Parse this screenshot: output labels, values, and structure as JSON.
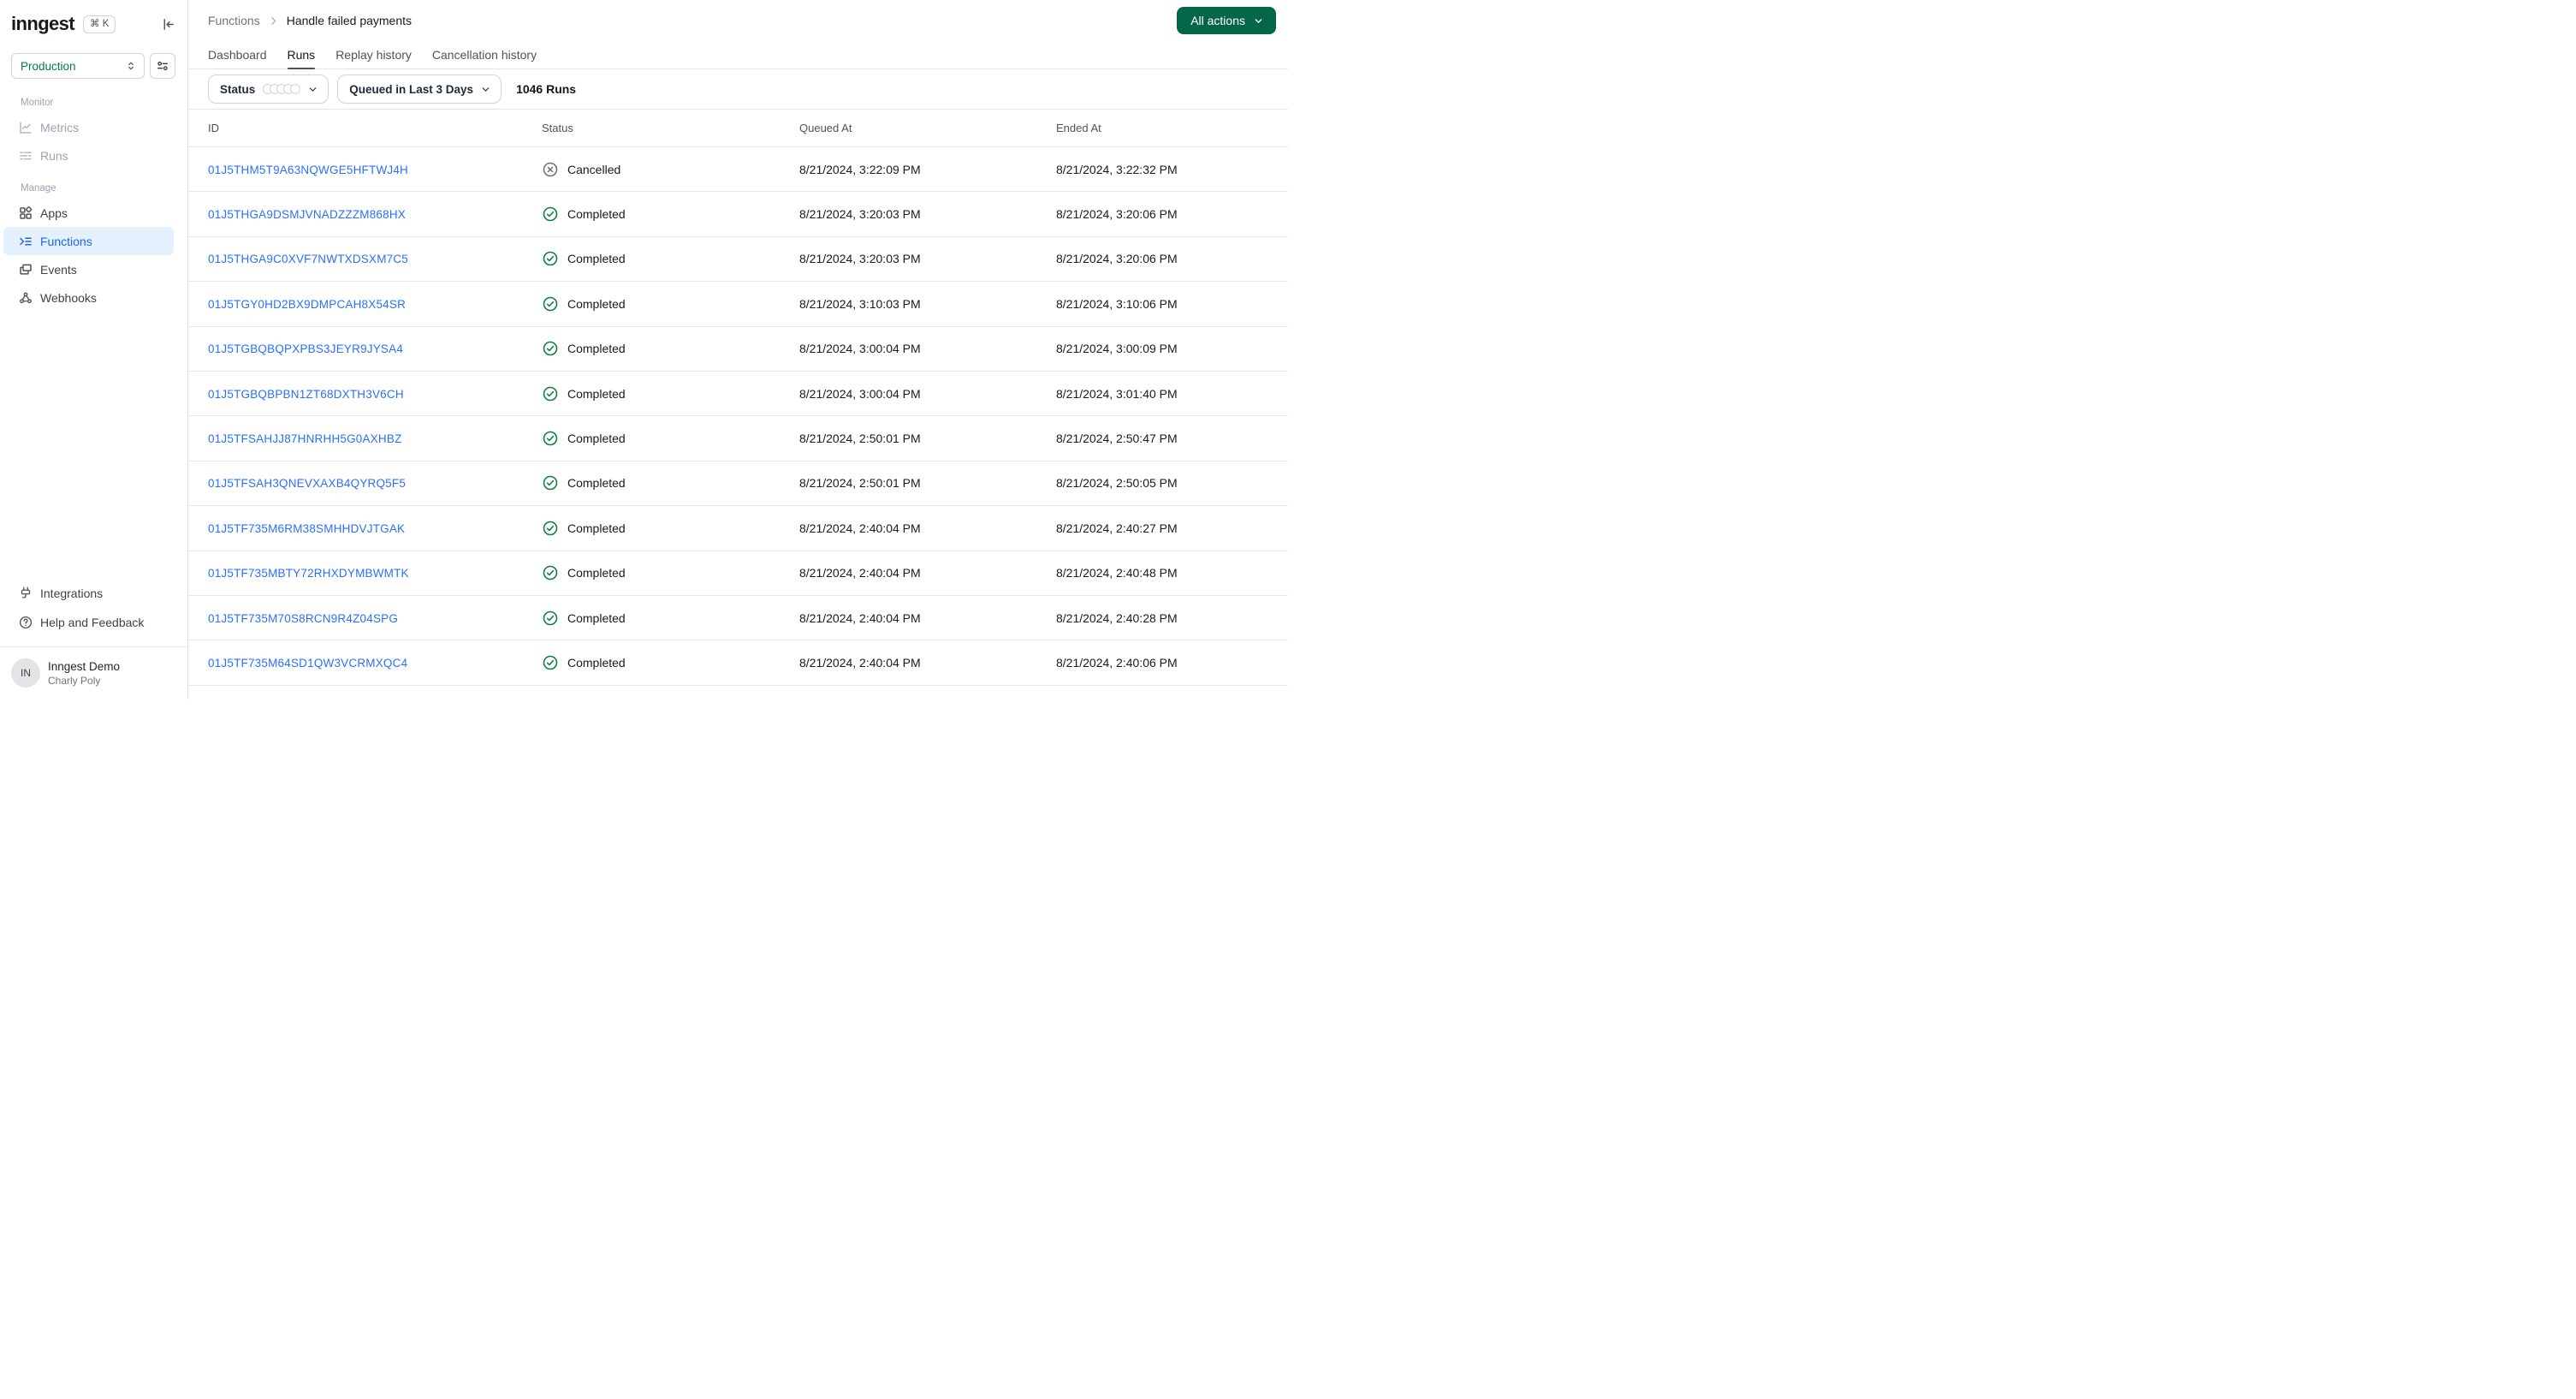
{
  "app": {
    "logo": "inngest",
    "command_shortcut": "⌘ K"
  },
  "environment": {
    "selected": "Production"
  },
  "sidebar": {
    "sections": [
      {
        "label": "Monitor",
        "items": [
          {
            "label": "Metrics"
          },
          {
            "label": "Runs"
          }
        ]
      },
      {
        "label": "Manage",
        "items": [
          {
            "label": "Apps"
          },
          {
            "label": "Functions",
            "active": true
          },
          {
            "label": "Events"
          },
          {
            "label": "Webhooks"
          }
        ]
      }
    ],
    "footer_items": [
      {
        "label": "Integrations"
      },
      {
        "label": "Help and Feedback"
      }
    ],
    "user": {
      "initials": "IN",
      "org": "Inngest Demo",
      "name": "Charly Poly"
    }
  },
  "header": {
    "breadcrumb": {
      "parent": "Functions",
      "current": "Handle failed payments"
    },
    "actions_button": "All actions",
    "tabs": [
      {
        "label": "Dashboard"
      },
      {
        "label": "Runs",
        "active": true
      },
      {
        "label": "Replay history"
      },
      {
        "label": "Cancellation history"
      }
    ]
  },
  "filters": {
    "status_label": "Status",
    "time_range_label": "Queued in Last 3 Days",
    "runs_count": "1046 Runs"
  },
  "table": {
    "columns": {
      "id": "ID",
      "status": "Status",
      "queued_at": "Queued At",
      "ended_at": "Ended At"
    },
    "rows": [
      {
        "id": "01J5THM5T9A63NQWGE5HFTWJ4H",
        "status": "Cancelled",
        "queued_at": "8/21/2024, 3:22:09 PM",
        "ended_at": "8/21/2024, 3:22:32 PM"
      },
      {
        "id": "01J5THGA9DSMJVNADZZZM868HX",
        "status": "Completed",
        "queued_at": "8/21/2024, 3:20:03 PM",
        "ended_at": "8/21/2024, 3:20:06 PM"
      },
      {
        "id": "01J5THGA9C0XVF7NWTXDSXM7C5",
        "status": "Completed",
        "queued_at": "8/21/2024, 3:20:03 PM",
        "ended_at": "8/21/2024, 3:20:06 PM"
      },
      {
        "id": "01J5TGY0HD2BX9DMPCAH8X54SR",
        "status": "Completed",
        "queued_at": "8/21/2024, 3:10:03 PM",
        "ended_at": "8/21/2024, 3:10:06 PM"
      },
      {
        "id": "01J5TGBQBQPXPBS3JEYR9JYSA4",
        "status": "Completed",
        "queued_at": "8/21/2024, 3:00:04 PM",
        "ended_at": "8/21/2024, 3:00:09 PM"
      },
      {
        "id": "01J5TGBQBPBN1ZT68DXTH3V6CH",
        "status": "Completed",
        "queued_at": "8/21/2024, 3:00:04 PM",
        "ended_at": "8/21/2024, 3:01:40 PM"
      },
      {
        "id": "01J5TFSAHJJ87HNRHH5G0AXHBZ",
        "status": "Completed",
        "queued_at": "8/21/2024, 2:50:01 PM",
        "ended_at": "8/21/2024, 2:50:47 PM"
      },
      {
        "id": "01J5TFSAH3QNEVXAXB4QYRQ5F5",
        "status": "Completed",
        "queued_at": "8/21/2024, 2:50:01 PM",
        "ended_at": "8/21/2024, 2:50:05 PM"
      },
      {
        "id": "01J5TF735M6RM38SMHHDVJTGAK",
        "status": "Completed",
        "queued_at": "8/21/2024, 2:40:04 PM",
        "ended_at": "8/21/2024, 2:40:27 PM"
      },
      {
        "id": "01J5TF735MBTY72RHXDYMBWMTK",
        "status": "Completed",
        "queued_at": "8/21/2024, 2:40:04 PM",
        "ended_at": "8/21/2024, 2:40:48 PM"
      },
      {
        "id": "01J5TF735M70S8RCN9R4Z04SPG",
        "status": "Completed",
        "queued_at": "8/21/2024, 2:40:04 PM",
        "ended_at": "8/21/2024, 2:40:28 PM"
      },
      {
        "id": "01J5TF735M64SD1QW3VCRMXQC4",
        "status": "Completed",
        "queued_at": "8/21/2024, 2:40:04 PM",
        "ended_at": "8/21/2024, 2:40:06 PM"
      }
    ]
  },
  "colors": {
    "accent_green": "#047a4e",
    "button_green": "#046648",
    "link_blue": "#2970ff",
    "active_blue": "#2563eb",
    "active_blue_bg": "#e3f1fe",
    "success_green": "#0d7d41",
    "cancelled_gray": "#6b7280"
  }
}
